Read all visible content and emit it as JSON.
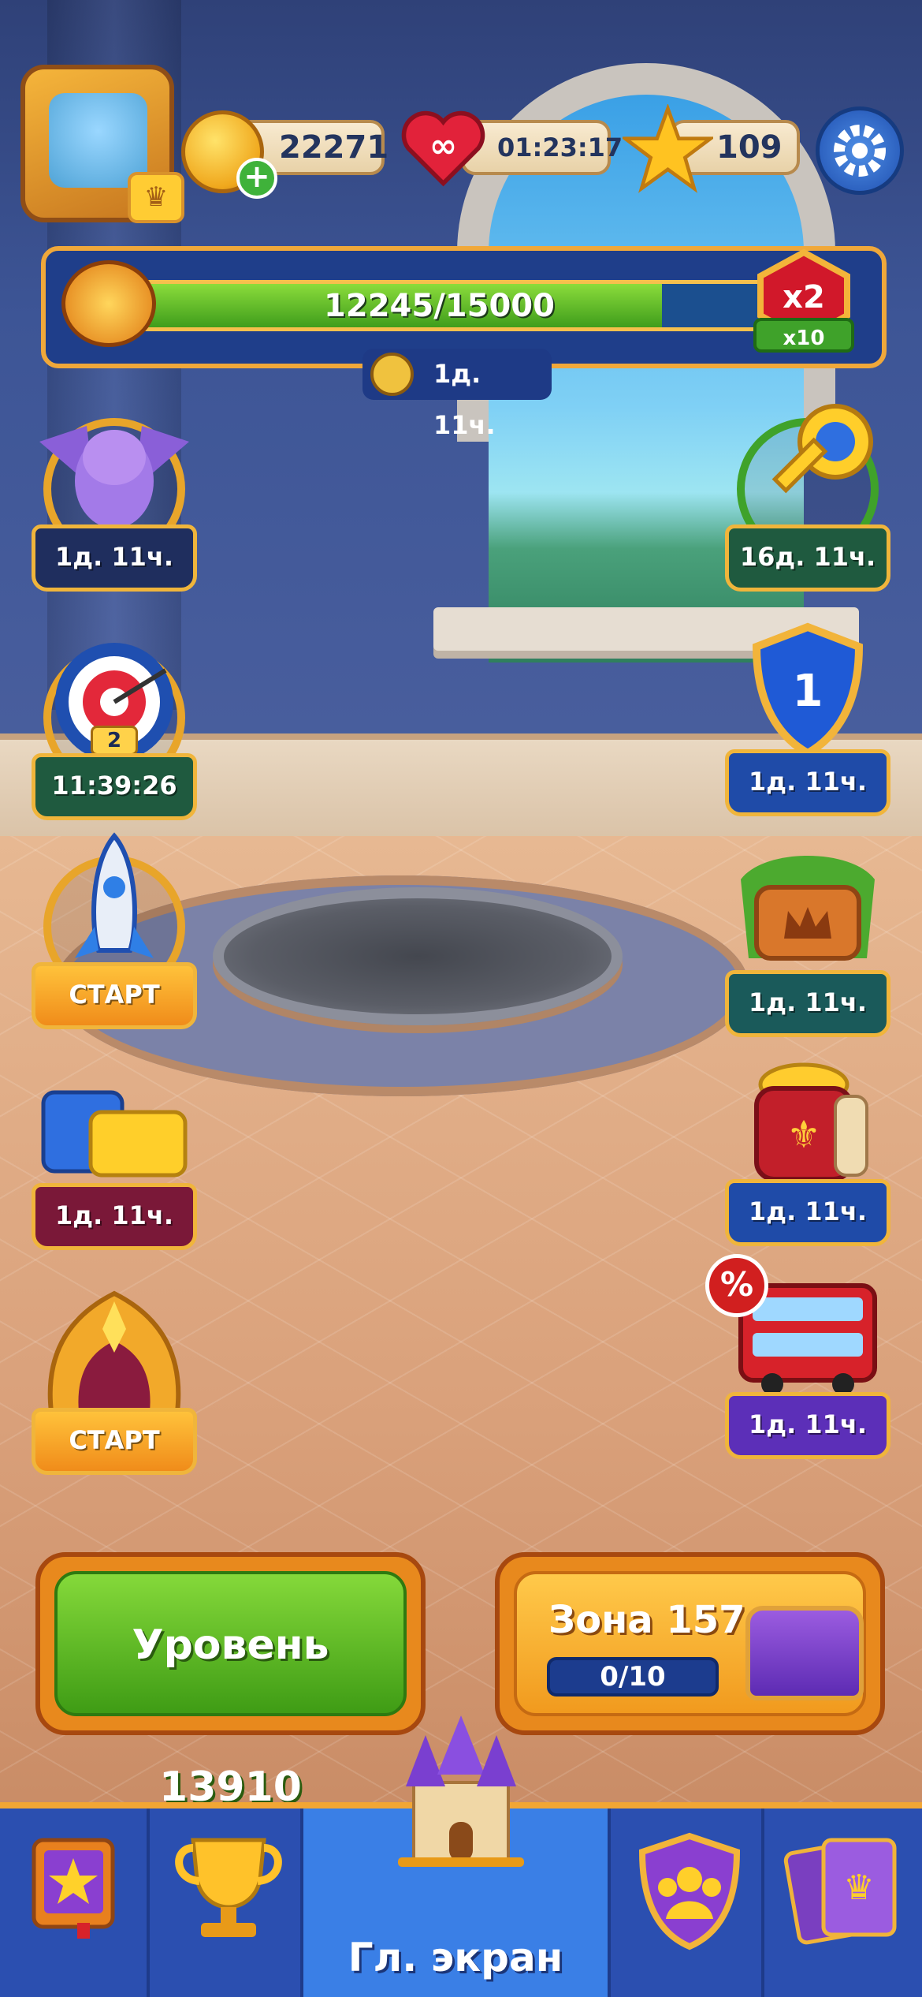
{
  "topbar": {
    "coins": "22271",
    "lives_timer": "01:23:17",
    "stars": "109"
  },
  "progress": {
    "label": "12245/15000",
    "fraction": 0.816,
    "multiplier": "x2",
    "multiplier_sub": "x10",
    "timer": "1д. 11ч."
  },
  "events_left": [
    {
      "label": "1д. 11ч.",
      "icon": "dragon-icon"
    },
    {
      "label": "11:39:26",
      "icon": "target-icon",
      "badge": "2"
    },
    {
      "label": "СТАРТ",
      "icon": "rocket-icon"
    },
    {
      "label": "1д. 11ч.",
      "icon": "puzzle-icon"
    },
    {
      "label": "СТАРТ",
      "icon": "crown-emblem-icon"
    }
  ],
  "events_right": [
    {
      "label": "16д. 11ч.",
      "icon": "key-icon"
    },
    {
      "label": "1д. 11ч.",
      "icon": "shield-icon",
      "badge": "1"
    },
    {
      "label": "1д. 11ч.",
      "icon": "wooden-sign-icon"
    },
    {
      "label": "1д. 11ч.",
      "icon": "treasure-bag-icon"
    },
    {
      "label": "1д. 11ч.",
      "icon": "bus-icon",
      "badge": "%"
    }
  ],
  "main": {
    "level_button": "Уровень 13910",
    "zone_title": "Зона 157",
    "zone_progress": "0/10"
  },
  "nav": {
    "home_label": "Гл. экран"
  },
  "colors": {
    "nav_bg": "#2b4fb0",
    "accent": "#f2a634",
    "progress_green": "#3f9d1c"
  }
}
